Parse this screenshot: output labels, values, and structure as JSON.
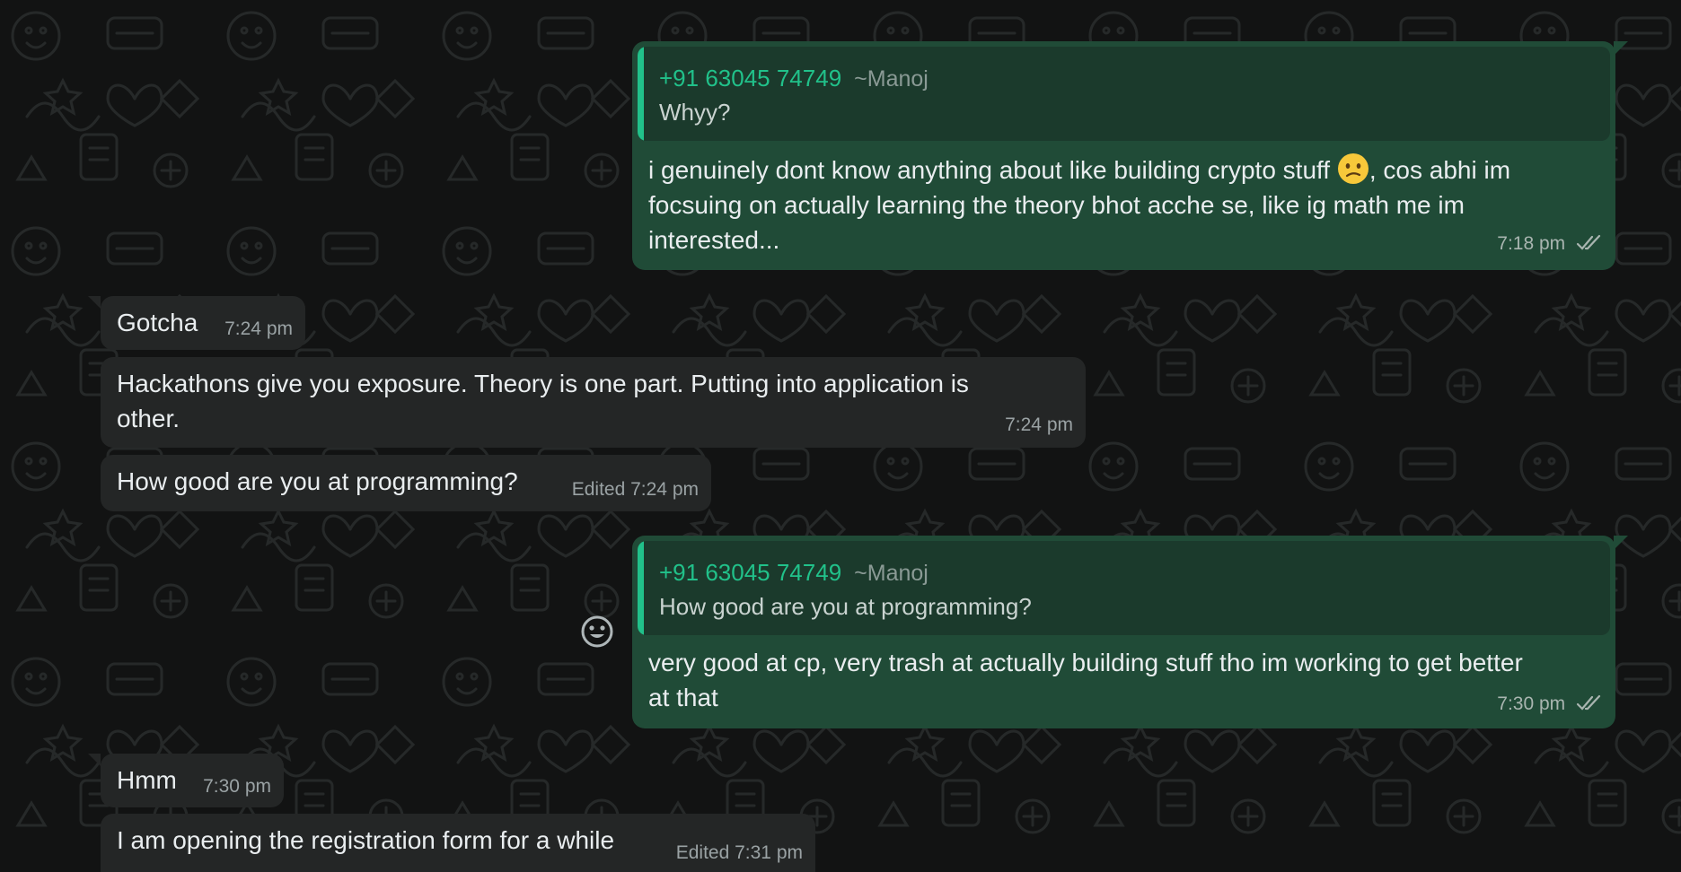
{
  "messages": [
    {
      "id": "m1",
      "direction": "outgoing",
      "quote": {
        "sender": "+91 63045 74749",
        "push_name": "~Manoj",
        "text": "Whyy?"
      },
      "text_line1_before": "i genuinely dont know anything about like building crypto stuff",
      "emoji": "confused-face",
      "text_line1_after": ", cos abhi im",
      "text_line2": "focsuing on actually learning the theory bhot acche se, like ig math me im",
      "text_line3": "interested...",
      "time": "7:18 pm",
      "status": "read"
    },
    {
      "id": "m2",
      "direction": "incoming",
      "text": "Gotcha",
      "time": "7:24 pm"
    },
    {
      "id": "m3",
      "direction": "incoming",
      "text_line1": "Hackathons give you exposure. Theory is one part. Putting into application is",
      "text_line2": "other.",
      "time": "7:24 pm"
    },
    {
      "id": "m4",
      "direction": "incoming",
      "text": "How good are you at programming?",
      "time": "Edited 7:24 pm"
    },
    {
      "id": "m5",
      "direction": "outgoing",
      "quote": {
        "sender": "+91 63045 74749",
        "push_name": "~Manoj",
        "text": "How good are you at programming?"
      },
      "text_line1": "very good at cp, very trash at actually building stuff tho im working to get better",
      "text_line2": "at that",
      "time": "7:30 pm",
      "status": "read"
    },
    {
      "id": "m6",
      "direction": "incoming",
      "text": "Hmm",
      "time": "7:30 pm"
    },
    {
      "id": "m7",
      "direction": "incoming",
      "text": "I am opening the registration form for a while",
      "time": "Edited 7:31 pm"
    }
  ],
  "icons": {
    "react": "smiley-react-icon",
    "read_ticks": "double-check-icon"
  },
  "colors": {
    "background": "#121313",
    "incoming_bubble": "#242626",
    "outgoing_bubble": "#204b37",
    "quote_accent": "#21c18a"
  }
}
